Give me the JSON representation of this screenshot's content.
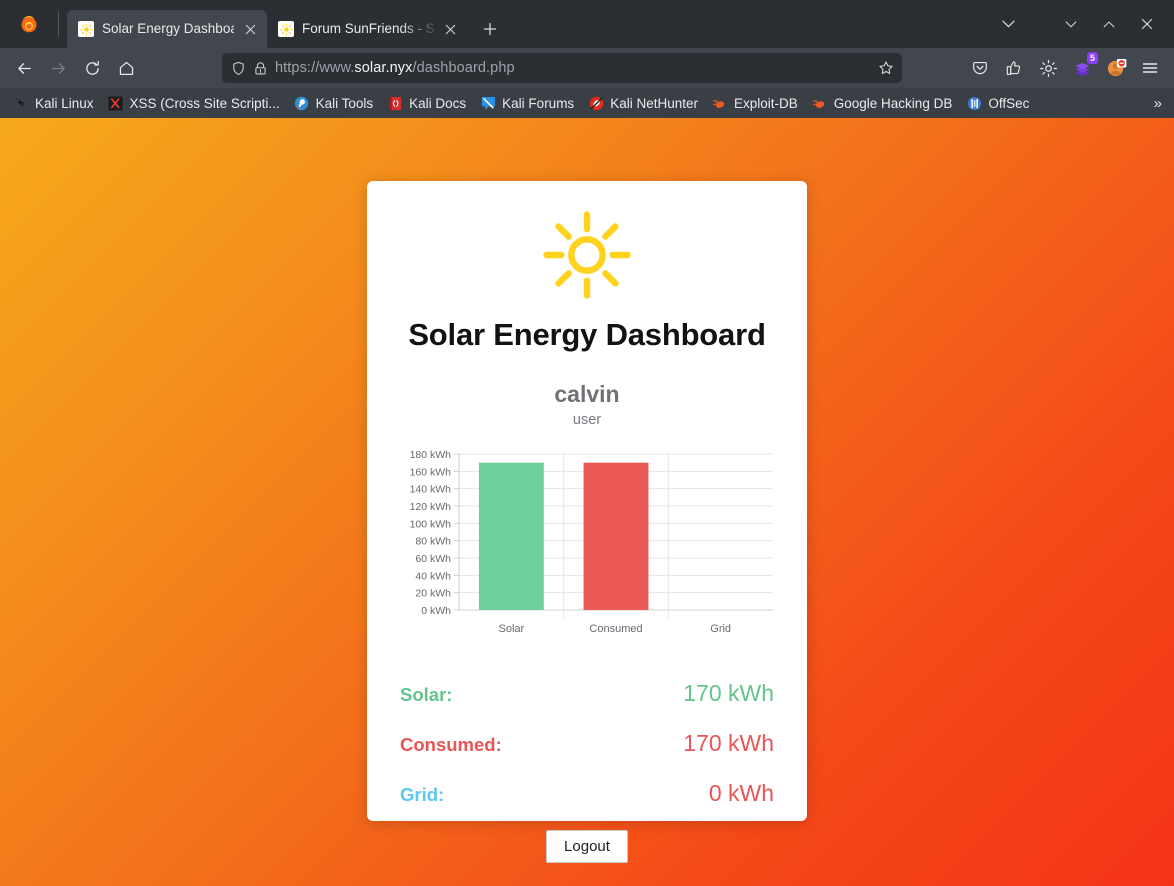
{
  "browser": {
    "tabs": [
      {
        "title": "Solar Energy Dashboard",
        "favicon": "sun-favicon",
        "active": true
      },
      {
        "title": "Forum SunFriends - Sola",
        "favicon": "sun-favicon",
        "active": false
      }
    ],
    "new_tab_label": "+",
    "url": {
      "scheme": "https://www.",
      "host": "solar.nyx",
      "path": "/dashboard.php"
    },
    "url_full": "https://www.solar.nyx/dashboard.php",
    "extension_badge_count": "5",
    "bookmarks": [
      {
        "label": "Kali Linux",
        "icon": "kali-dragon-icon"
      },
      {
        "label": "XSS (Cross Site Scripti...",
        "icon": "xss-icon"
      },
      {
        "label": "Kali Tools",
        "icon": "kali-tools-icon"
      },
      {
        "label": "Kali Docs",
        "icon": "kali-docs-icon"
      },
      {
        "label": "Kali Forums",
        "icon": "kali-forums-icon"
      },
      {
        "label": "Kali NetHunter",
        "icon": "nethunter-icon"
      },
      {
        "label": "Exploit-DB",
        "icon": "exploitdb-icon"
      },
      {
        "label": "Google Hacking DB",
        "icon": "ghdb-icon"
      },
      {
        "label": "OffSec",
        "icon": "offsec-icon"
      }
    ],
    "bookmarks_overflow": "»"
  },
  "page": {
    "title": "Solar Energy Dashboard",
    "username": "calvin",
    "role": "user",
    "logout_label": "Logout",
    "stats": [
      {
        "label": "Solar:",
        "value": "170 kWh",
        "label_color": "#63c48c",
        "value_color": "#63c48c"
      },
      {
        "label": "Consumed:",
        "value": "170 kWh",
        "label_color": "#ea5455",
        "value_color": "#ea5455"
      },
      {
        "label": "Grid:",
        "value": "0 kWh",
        "label_color": "#5ac8f0",
        "value_color": "#ea5455"
      }
    ]
  },
  "chart_data": {
    "type": "bar",
    "title": "",
    "xlabel": "",
    "ylabel": "",
    "categories": [
      "Solar",
      "Consumed",
      "Grid"
    ],
    "values": [
      170,
      170,
      0
    ],
    "unit": "kWh",
    "ylim": [
      0,
      180
    ],
    "ytick_step": 20,
    "ytick_labels": [
      "0 kWh",
      "20 kWh",
      "40 kWh",
      "60 kWh",
      "80 kWh",
      "100 kWh",
      "120 kWh",
      "140 kWh",
      "160 kWh",
      "180 kWh"
    ],
    "bar_colors": [
      "#6ecf9a",
      "#ec5a57",
      "#6ecf9a"
    ],
    "grid": true,
    "legend": false
  }
}
